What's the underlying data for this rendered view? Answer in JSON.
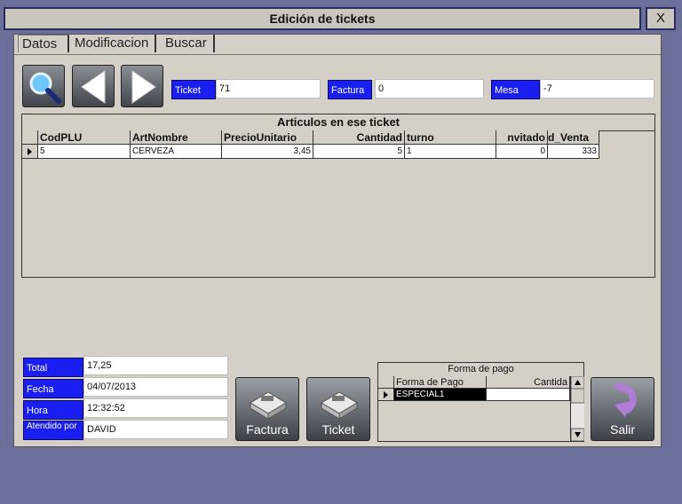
{
  "window": {
    "title": "Edición de tickets",
    "close_label": "X"
  },
  "tabs": [
    {
      "label": "Datos",
      "active": true
    },
    {
      "label": "Modificacion",
      "active": false
    },
    {
      "label": "Buscar",
      "active": false
    }
  ],
  "toolbar": {
    "search_icon": "magnifier-icon",
    "prev_icon": "arrow-left-icon",
    "next_icon": "arrow-right-icon"
  },
  "fields": {
    "ticket": {
      "label": "Ticket",
      "value": "71"
    },
    "factura": {
      "label": "Factura",
      "value": "0"
    },
    "mesa": {
      "label": "Mesa",
      "value": "-7"
    }
  },
  "articles": {
    "title": "Articulos en ese ticket",
    "columns": [
      "CodPLU",
      "ArtNombre",
      "PrecioUnitario",
      "Cantidad",
      "turno",
      "nvitado",
      "d_Venta"
    ],
    "rows": [
      [
        "5",
        "CERVEZA",
        "3,45",
        "5",
        "1",
        "0",
        "333"
      ]
    ]
  },
  "summary": {
    "total": {
      "label": "Total",
      "value": "17,25"
    },
    "fecha": {
      "label": "Fecha",
      "value": "04/07/2013"
    },
    "hora": {
      "label": "Hora",
      "value": "12:32:52"
    },
    "atendido": {
      "label": "Atendido por",
      "value": "DAVID"
    }
  },
  "actions": {
    "factura_label": "Factura",
    "ticket_label": "Ticket",
    "salir_label": "Salir"
  },
  "payment": {
    "title": "Forma de pago",
    "columns": [
      "Forma de Pago",
      "Cantida"
    ],
    "rows": [
      [
        "ESPECIAL1",
        ""
      ]
    ]
  },
  "colors": {
    "label_blue": "#1a1ef0",
    "background": "#6b6f9a",
    "panel": "#d4d0c8"
  }
}
